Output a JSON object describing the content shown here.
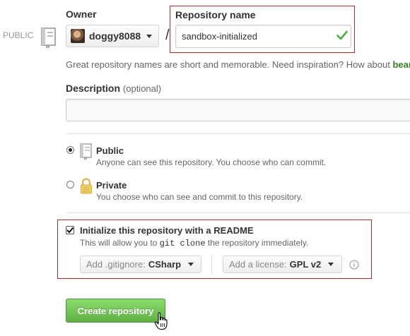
{
  "visibility_tag": "PUBLIC",
  "owner": {
    "label": "Owner",
    "username": "doggy8088"
  },
  "slash": "/",
  "repository_name": {
    "label": "Repository name",
    "value": "sandbox-initialized",
    "status_icon": "check-icon"
  },
  "hint": {
    "text": "Great repository names are short and memorable. Need inspiration? How about ",
    "suggestion": "bean"
  },
  "description": {
    "label": "Description",
    "optional": "(optional)",
    "value": ""
  },
  "visibility": {
    "selected": "public",
    "public": {
      "title": "Public",
      "desc": "Anyone can see this repository. You choose who can commit.",
      "icon": "repo-book-icon"
    },
    "private": {
      "title": "Private",
      "desc": "You choose who can see and commit to this repository.",
      "icon": "lock-icon"
    }
  },
  "initialize": {
    "checked": true,
    "title": "Initialize this repository with a README",
    "desc_before": "This will allow you to ",
    "desc_code": "git clone",
    "desc_after": " the repository immediately."
  },
  "gitignore": {
    "prefix": "Add .gitignore:",
    "value": "CSharp"
  },
  "license": {
    "prefix": "Add a license:",
    "value": "GPL v2"
  },
  "create_button": "Create repository",
  "colors": {
    "accent_green": "#60b044",
    "highlight_red": "#b52a2a",
    "link_green": "#3c7d2c"
  }
}
